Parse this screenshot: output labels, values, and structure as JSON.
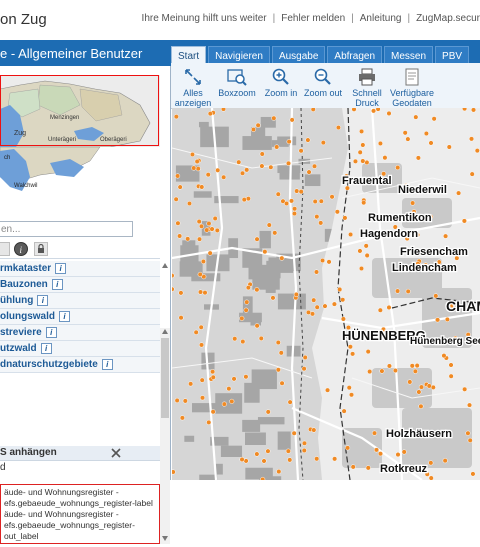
{
  "header": {
    "title": "on Zug",
    "links": [
      "Ihre Meinung hilft uns weiter",
      "Fehler melden",
      "Anleitung",
      "ZugMap.secur"
    ]
  },
  "portal": {
    "title": "e - Allgemeiner Benutzer"
  },
  "tabs": [
    {
      "label": "Start",
      "active": true
    },
    {
      "label": "Navigieren",
      "active": false
    },
    {
      "label": "Ausgabe",
      "active": false
    },
    {
      "label": "Abfragen",
      "active": false
    },
    {
      "label": "Messen",
      "active": false
    },
    {
      "label": "PBV",
      "active": false
    }
  ],
  "toolbar": {
    "tools": [
      {
        "label1": "Alles",
        "label2": "anzeigen",
        "icon": "zoom-extent-icon"
      },
      {
        "label1": "Boxzoom",
        "label2": "",
        "icon": "boxzoom-icon"
      },
      {
        "label1": "Zoom in",
        "label2": "",
        "icon": "zoom-in-icon"
      },
      {
        "label1": "Zoom out",
        "label2": "",
        "icon": "zoom-out-icon"
      },
      {
        "label1": "Schnell",
        "label2": "Druck",
        "icon": "printer-icon"
      },
      {
        "label1": "Verfügbare",
        "label2": "Geodaten",
        "icon": "geodata-icon"
      }
    ]
  },
  "overview": {
    "labels": [
      "Zug",
      "Menzingen",
      "Unterägeri",
      "Oberägeri",
      "ch",
      "Walchwil"
    ]
  },
  "sidebar": {
    "search_placeholder": "en...",
    "layers": [
      {
        "label": "rmkataster"
      },
      {
        "label": "Bauzonen"
      },
      {
        "label": "ühlung"
      },
      {
        "label": "olungswald"
      },
      {
        "label": "streviere"
      },
      {
        "label": "utzwald"
      },
      {
        "label": "dnaturschutzgebiete"
      }
    ],
    "attach_header": "S anhängen",
    "attach_sub": "d",
    "results": [
      "äude- und Wohnungsregister -",
      "efs.gebaeude_wohnungs_register-label",
      "äude- und Wohnungsregister -",
      "efs.gebaeude_wohnungs_register-",
      "out_label"
    ]
  },
  "map": {
    "places": [
      {
        "name": "Frauental"
      },
      {
        "name": "Niederwil"
      },
      {
        "name": "Rumentikon"
      },
      {
        "name": "Hagendorn"
      },
      {
        "name": "Friesencham"
      },
      {
        "name": "Lindencham"
      },
      {
        "name": "CHAM"
      },
      {
        "name": "HÜNENBERG"
      },
      {
        "name": "Hünenberg See"
      },
      {
        "name": "Holzhäusern"
      },
      {
        "name": "Rotkreuz"
      }
    ],
    "colors": {
      "marker": "#f08a24",
      "settlement": "#a6a6a6",
      "road": "#ffffff",
      "boundary": "#333333"
    }
  }
}
